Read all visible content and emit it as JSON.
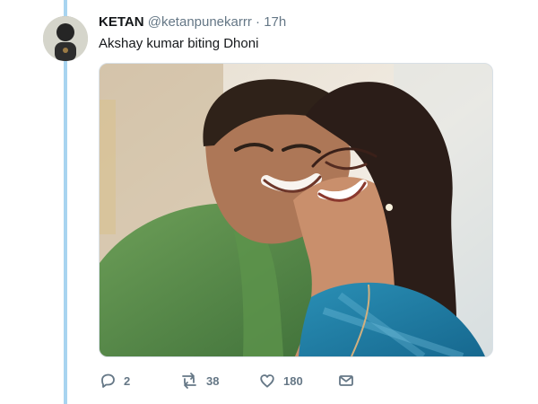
{
  "tweet": {
    "display_name": "KETAN",
    "handle": "@ketanpunekarrr",
    "separator": "·",
    "time": "17h",
    "text": "Akshay kumar biting Dhoni"
  },
  "actions": {
    "reply_count": "2",
    "retweet_count": "38",
    "like_count": "180"
  },
  "icons": {
    "reply": "reply-icon",
    "retweet": "retweet-icon",
    "like": "heart-icon",
    "direct_message": "envelope-icon"
  },
  "colors": {
    "muted_text": "#657786",
    "thread_line": "#a8d4f0",
    "name_text": "#14171a"
  }
}
